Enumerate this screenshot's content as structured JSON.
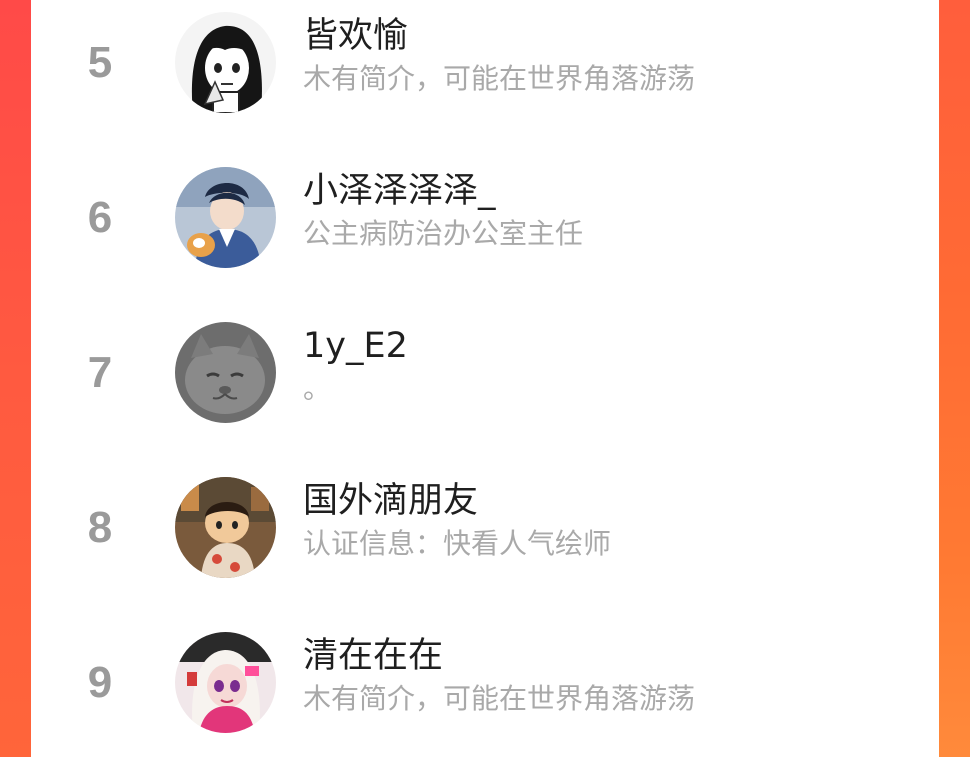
{
  "colors": {
    "page_background": "#ff5a3d",
    "card_background": "#ffffff",
    "rank_text": "#9a9a9a",
    "name_text": "#1f1f1f",
    "bio_text": "#a9a9a9"
  },
  "ranking": [
    {
      "rank": "5",
      "name": "皆欢愉",
      "bio": "木有简介，可能在世界角落游荡",
      "avatar_icon": "manga-girl-avatar"
    },
    {
      "rank": "6",
      "name": "小泽泽泽泽_",
      "bio": "公主病防治办公室主任",
      "avatar_icon": "anime-boy-with-dog-avatar"
    },
    {
      "rank": "7",
      "name": "1y_E2",
      "bio": "。",
      "avatar_icon": "grey-cat-avatar"
    },
    {
      "rank": "8",
      "name": "国外滴朋友",
      "bio": "认证信息：快看人气绘师",
      "avatar_icon": "anime-child-avatar"
    },
    {
      "rank": "9",
      "name": "清在在在",
      "bio": "木有简介，可能在世界角落游荡",
      "avatar_icon": "white-hair-girl-avatar"
    }
  ]
}
